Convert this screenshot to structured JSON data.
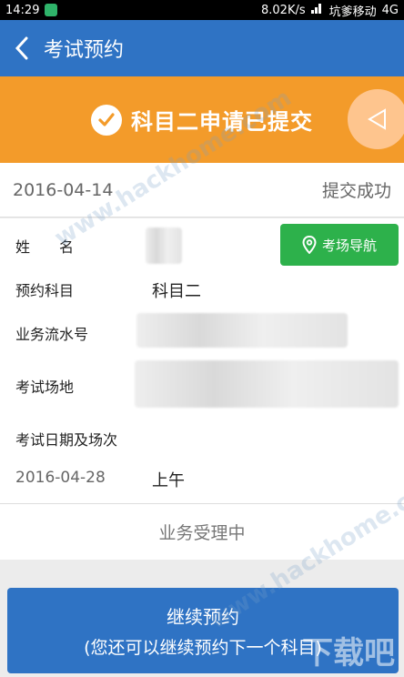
{
  "status_bar": {
    "time": "14:29",
    "network_speed": "8.02K/s",
    "carrier": "坑爹移动",
    "network_type": "4G"
  },
  "app_bar": {
    "title": "考试预约",
    "back_icon": "chevron-left-icon"
  },
  "banner": {
    "message": "科目二申请已提交",
    "icon": "check-circle-icon",
    "bg_color": "#f39b2a"
  },
  "submission": {
    "date": "2016-04-14",
    "status": "提交成功"
  },
  "details": {
    "name_label": "姓　　名",
    "subject_label": "预约科目",
    "subject_value": "科目二",
    "serial_label": "业务流水号",
    "venue_label": "考试场地",
    "datetime_label": "考试日期及场次",
    "exam_date": "2016-04-28",
    "exam_session": "上午",
    "nav_button": "考场导航"
  },
  "processing_status": "业务受理中",
  "continue_button": {
    "line1": "继续预约",
    "line2": "(您还可以继续预约下一个科目)"
  },
  "watermarks": {
    "site": "www.hackhome.com",
    "logo": "下载吧"
  },
  "colors": {
    "primary_blue": "#2f73c4",
    "banner_orange": "#f39b2a",
    "nav_green": "#2db14b"
  }
}
